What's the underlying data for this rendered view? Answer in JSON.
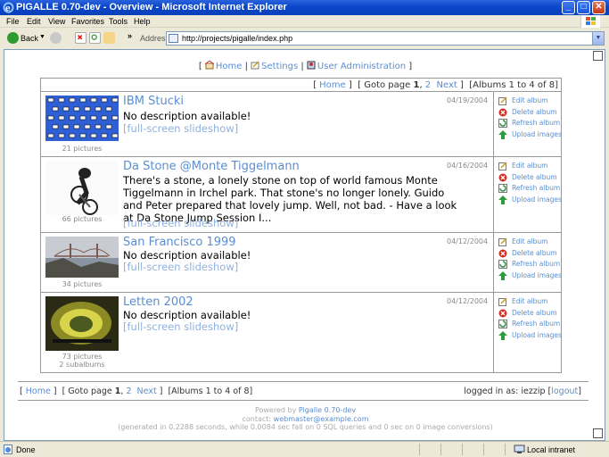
{
  "window": {
    "title": "PIGALLE 0.70-dev - Overview - Microsoft Internet Explorer"
  },
  "menubar": {
    "items": [
      "File",
      "Edit",
      "View",
      "Favorites",
      "Tools",
      "Help"
    ]
  },
  "toolbar": {
    "back_label": "Back",
    "address_label": "Address",
    "url": "http://projects/pigalle/index.php"
  },
  "topnav": {
    "home": "Home",
    "settings": "Settings",
    "user_admin": "User Administration"
  },
  "pager": {
    "home": "Home",
    "goto_prefix": "Goto page ",
    "current_page": "1",
    "other_page": "2",
    "next": "Next",
    "albums_range": "Albums 1 to 4 of 8"
  },
  "actions": {
    "edit": "Edit album",
    "delete": "Delete album",
    "refresh": "Refresh album",
    "upload": "Upload images"
  },
  "albums": [
    {
      "title": "IBM Stucki",
      "date": "04/19/2004",
      "description": "No description available!",
      "slideshow": "[full-screen slideshow]",
      "pictures": "21 pictures",
      "subalbums": ""
    },
    {
      "title": "Da Stone @Monte Tiggelmann",
      "date": "04/16/2004",
      "description": "There's a stone, a lonely stone on top of world famous Monte Tiggelmann in Irchel park. That stone's no longer lonely. Guido and Peter prepared that lovely jump. Well, not bad. - Have a look at Da Stone Jump Session I...",
      "slideshow": "[full-screen slideshow]",
      "pictures": "66 pictures",
      "subalbums": ""
    },
    {
      "title": "San Francisco 1999",
      "date": "04/12/2004",
      "description": "No description available!",
      "slideshow": "[full-screen slideshow]",
      "pictures": "34 pictures",
      "subalbums": ""
    },
    {
      "title": "Letten 2002",
      "date": "04/12/2004",
      "description": "No description available!",
      "slideshow": "[full-screen slideshow]",
      "pictures": "73 pictures",
      "subalbums": "2 subalbums"
    }
  ],
  "footer": {
    "logged_in_label": "logged in as: ",
    "username": "iezzip",
    "logout": "logout",
    "powered_prefix": "Powered by ",
    "powered_link": "Pigalle 0.70-dev",
    "contact_prefix": "contact: ",
    "contact_email": "webmaster@example.com",
    "generated": "(generated in 0.2288 seconds, while 0.0084 sec fall on 0 SQL queries and 0 sec on 0 image conversions)"
  },
  "statusbar": {
    "status": "Done",
    "zone": "Local intranet"
  },
  "colors": {
    "link": "#5b8ed1",
    "titlebar": "#0b46c9"
  }
}
